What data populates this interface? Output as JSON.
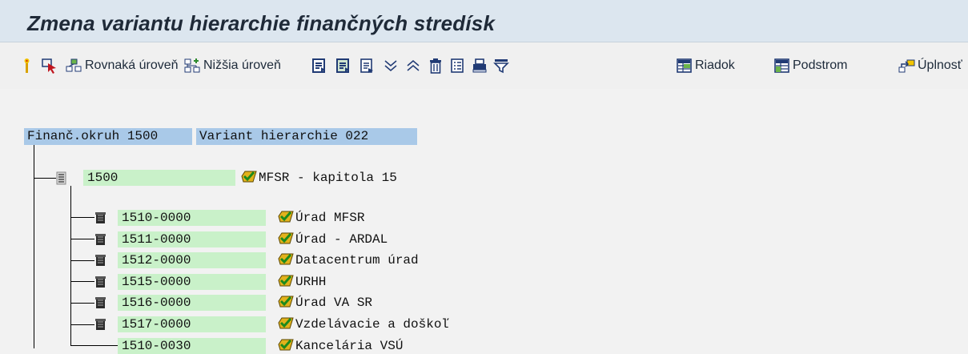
{
  "window": {
    "title": "Zmena variantu hierarchie finančných stredísk"
  },
  "toolbar": {
    "same_level_label": "Rovnaká úroveň",
    "lower_level_label": "Nižšia úroveň",
    "row_label": "Riadok",
    "subtree_label": "Podstrom",
    "completeness_label": "Úplnosť"
  },
  "header": {
    "area_label": "Finanč.okruh 1500",
    "variant_label": "Variant hierarchie 022"
  },
  "tree": {
    "root": {
      "code": "1500",
      "description": "MFSR - kapitola 15"
    },
    "children": [
      {
        "code": "1510-0000",
        "description": "Úrad MFSR"
      },
      {
        "code": "1511-0000",
        "description": "Úrad - ARDAL"
      },
      {
        "code": "1512-0000",
        "description": "Datacentrum úrad"
      },
      {
        "code": "1515-0000",
        "description": "URHH"
      },
      {
        "code": "1516-0000",
        "description": "Úrad VA SR"
      },
      {
        "code": "1517-0000",
        "description": "Vzdelávacie a doškoľ"
      },
      {
        "code": "1510-0030",
        "description": "Kancelária VSÚ"
      }
    ]
  },
  "colors": {
    "title_bg": "#dce6ef",
    "header_box": "#a9c9e8",
    "key_box": "#c9f1c9",
    "check_icon": "#e2b21b"
  }
}
